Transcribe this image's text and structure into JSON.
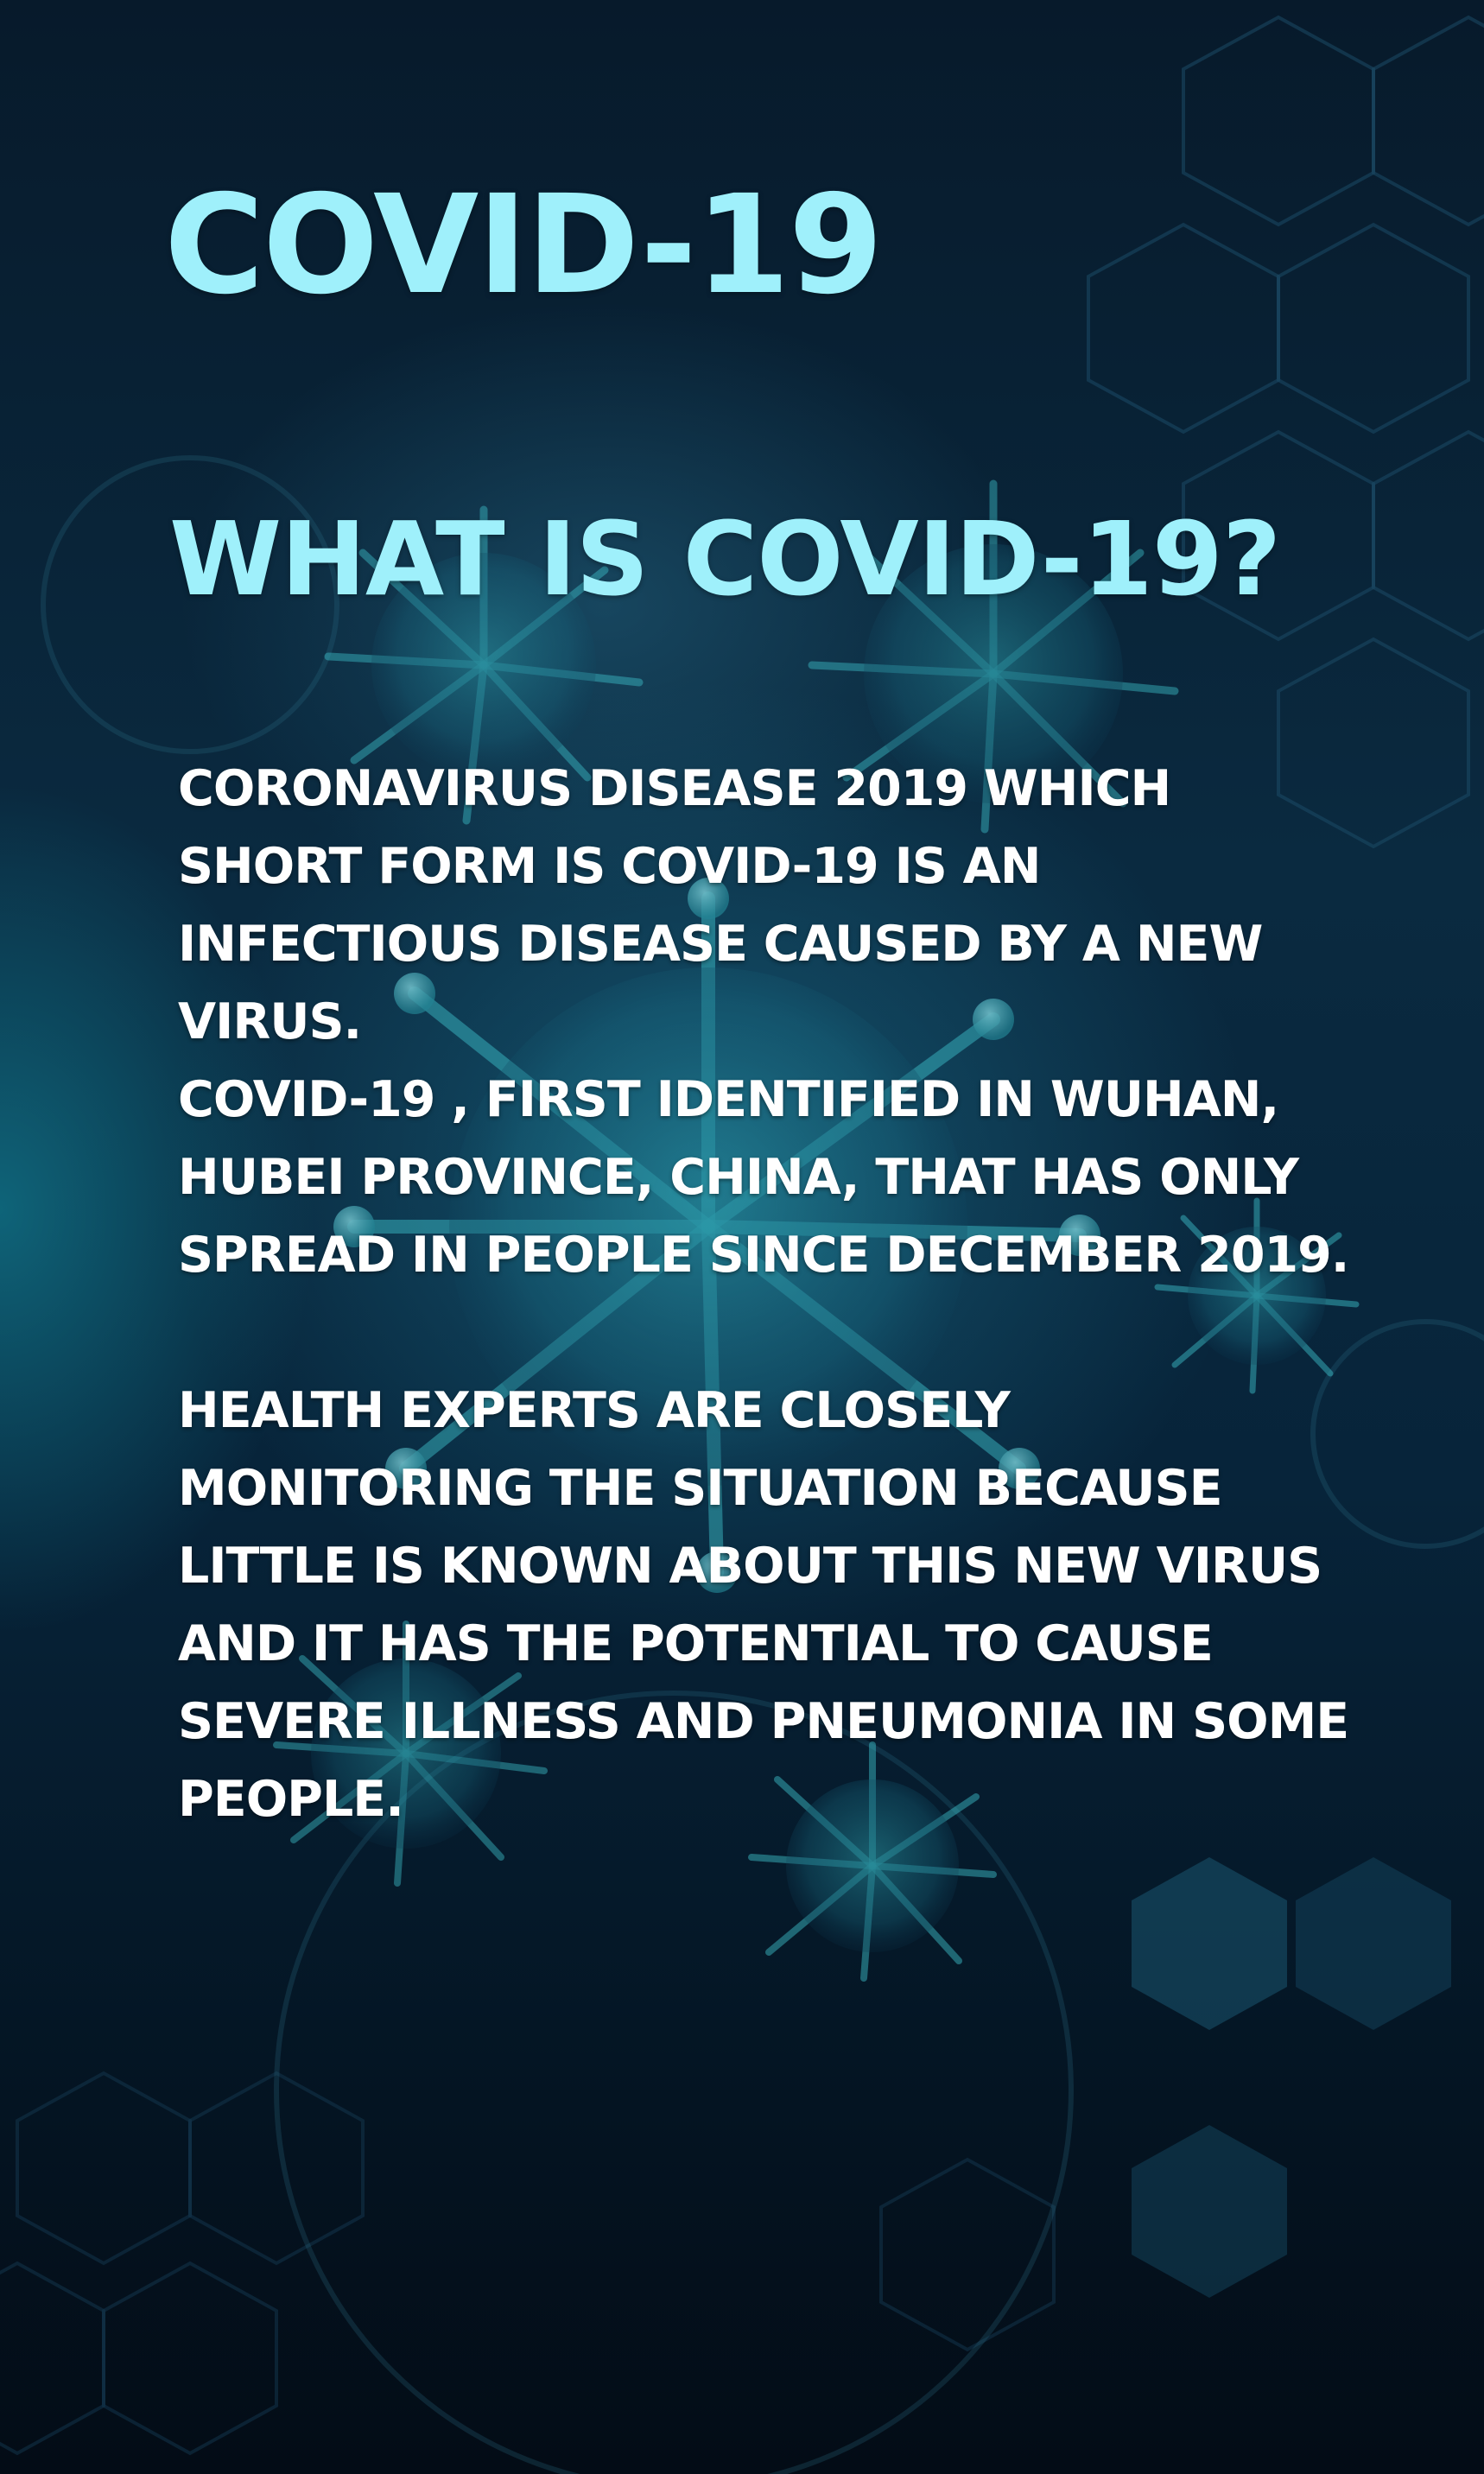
{
  "poster": {
    "title": "COVID-19",
    "heading": "WHAT IS COVID-19?",
    "paragraphs": [
      "CORONAVIRUS DISEASE 2019 WHICH SHORT FORM IS COVID-19 IS AN INFECTIOUS DISEASE CAUSED BY A NEW VIRUS.",
      "COVID-19 , FIRST IDENTIFIED IN WUHAN, HUBEI PROVINCE, CHINA, THAT HAS ONLY SPREAD IN PEOPLE SINCE DECEMBER 2019.",
      "HEALTH EXPERTS ARE CLOSELY MONITORING THE SITUATION BECAUSE LITTLE IS KNOWN ABOUT THIS NEW VIRUS AND IT HAS THE POTENTIAL TO CAUSE SEVERE ILLNESS AND PNEUMONIA IN SOME PEOPLE."
    ]
  },
  "colors": {
    "title": "#9ff0fb",
    "body_text": "#ffffff",
    "background": "#071a2b",
    "virus_accent": "#3fc6d0"
  },
  "background_art": {
    "icons": [
      "virus-particle-icon",
      "hexagon-pattern-icon"
    ]
  }
}
